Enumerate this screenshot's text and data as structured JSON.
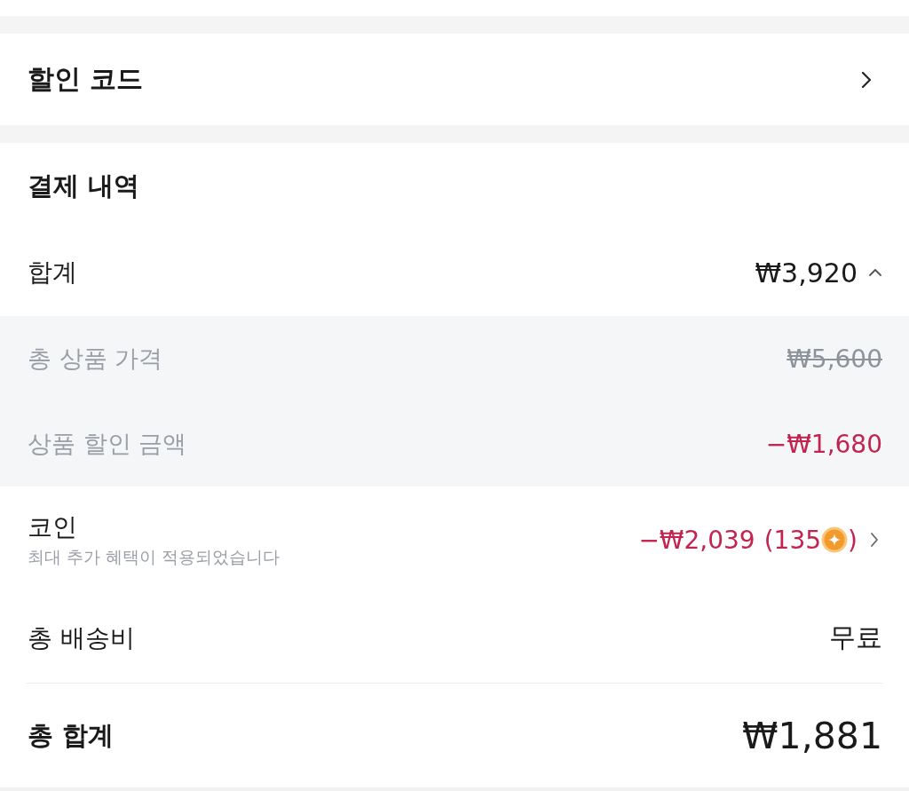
{
  "discount_code": {
    "label": "할인 코드"
  },
  "payment_details": {
    "title": "결제 내역",
    "subtotal": {
      "label": "합계",
      "value": "₩3,920",
      "expanded": true
    },
    "breakdown": [
      {
        "kind": "original",
        "label": "총 상품 가격",
        "value": "₩5,600"
      },
      {
        "kind": "discount",
        "label": "상품 할인 금액",
        "value": "−₩1,680"
      }
    ],
    "coins": {
      "label": "코인",
      "note": "최대 추가 혜택이 적용되었습니다",
      "value": "−₩2,039",
      "count": "(135",
      "count_end": ")"
    },
    "shipping": {
      "label": "총 배송비",
      "value": "무료"
    },
    "total": {
      "label": "총 합계",
      "value": "₩1,881"
    }
  }
}
